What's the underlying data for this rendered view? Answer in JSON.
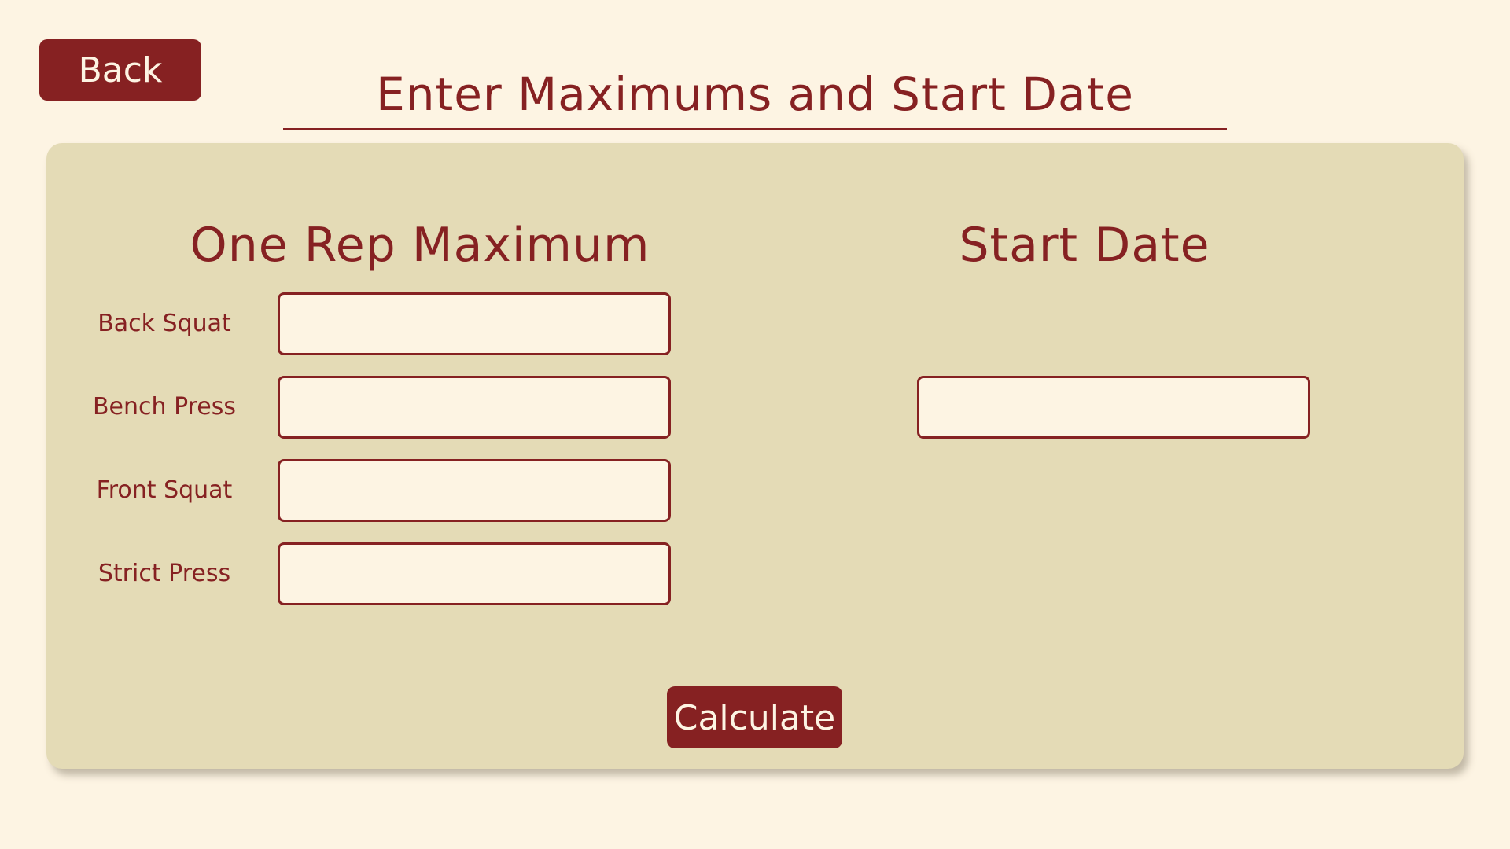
{
  "header": {
    "back_label": "Back",
    "title": "Enter Maximums and Start Date"
  },
  "one_rep_max": {
    "heading": "One Rep Maximum",
    "lifts": [
      {
        "label": "Back Squat",
        "value": ""
      },
      {
        "label": "Bench Press",
        "value": ""
      },
      {
        "label": "Front Squat",
        "value": ""
      },
      {
        "label": "Strict Press",
        "value": ""
      }
    ]
  },
  "start_date": {
    "heading": "Start Date",
    "value": ""
  },
  "actions": {
    "calculate_label": "Calculate"
  },
  "colors": {
    "background": "#fdf4e3",
    "panel": "#e4dbb6",
    "accent": "#862122"
  }
}
